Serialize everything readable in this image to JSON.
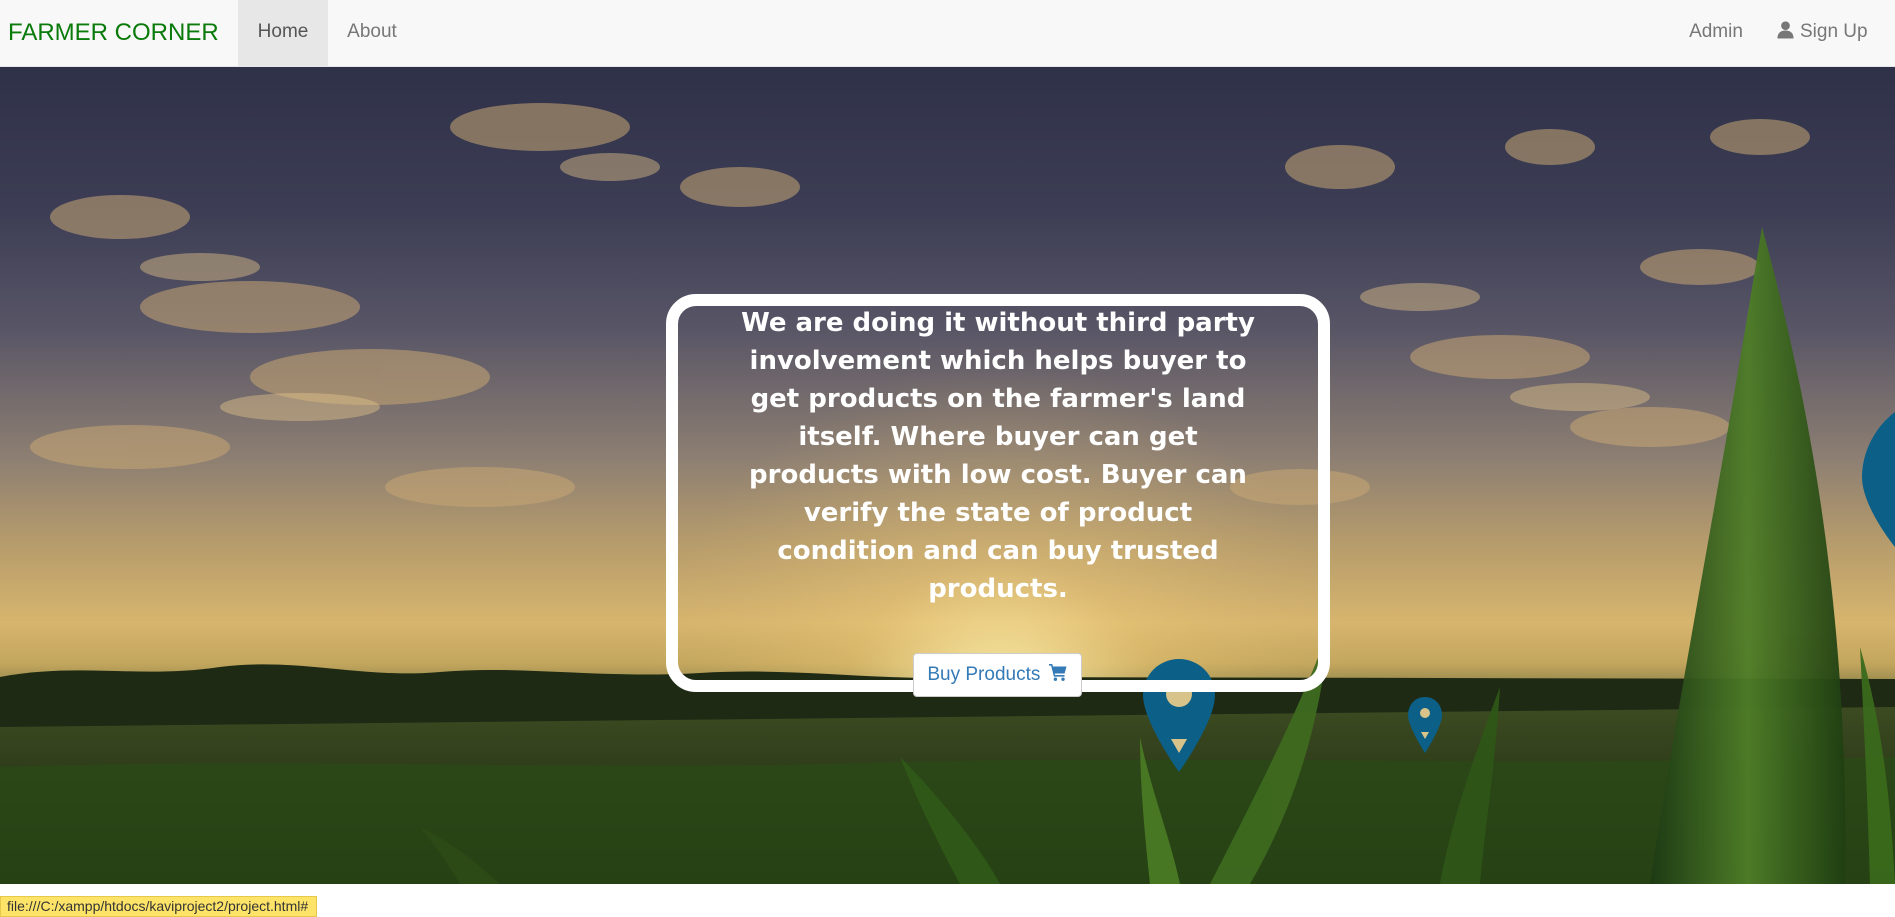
{
  "navbar": {
    "brand": "FARMER CORNER",
    "items": [
      {
        "label": "Home",
        "active": true
      },
      {
        "label": "About",
        "active": false
      }
    ],
    "right_items": [
      {
        "label": "Admin"
      },
      {
        "label": "Sign Up",
        "icon": "user-icon"
      }
    ]
  },
  "hero": {
    "message": "We are doing it without third party involvement which helps buyer to get products on the farmer's land itself. Where buyer can get products with low cost. Buyer can verify the state of product condition and can buy trusted products.",
    "button_label": "Buy Products",
    "button_icon": "shopping-cart-icon"
  },
  "status_bar": {
    "url": "file:///C:/xampp/htdocs/kaviproject2/project.html#"
  },
  "colors": {
    "brand": "#0a7a0a",
    "link": "#337ab7",
    "navbar_bg": "#f8f8f8",
    "active_tab_bg": "#e7e7e7",
    "status_bar_bg": "#fde469"
  }
}
